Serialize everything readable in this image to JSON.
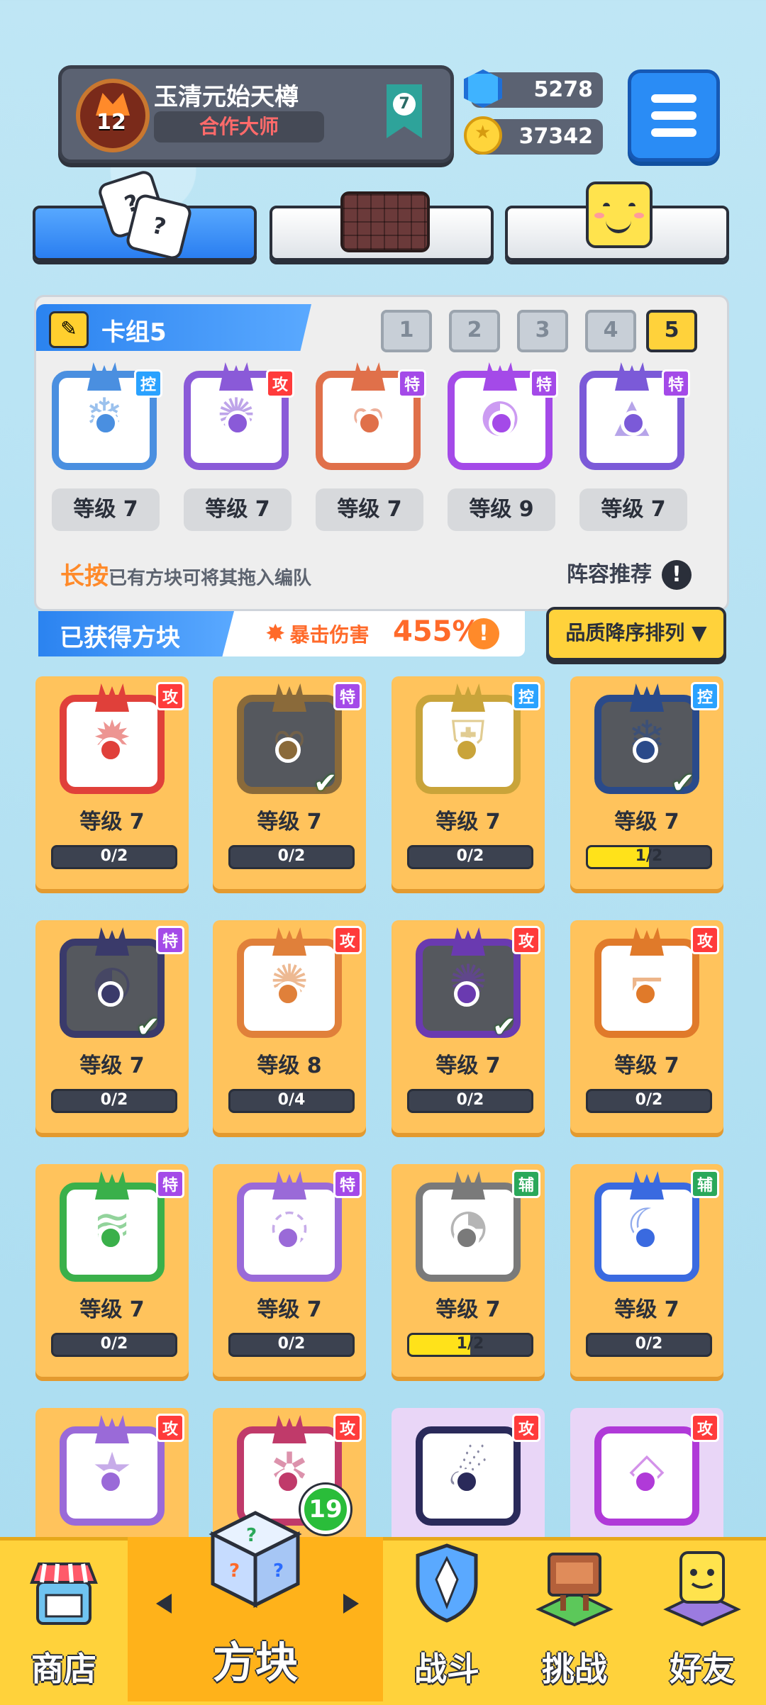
{
  "profile": {
    "level": "12",
    "name": "玉清元始天樽",
    "title": "合作大师",
    "rank": "7"
  },
  "currency": {
    "gems": "5278",
    "coins": "37342"
  },
  "tabs": [
    {
      "name": "dice"
    },
    {
      "name": "board"
    },
    {
      "name": "emoji"
    }
  ],
  "deck": {
    "label": "卡组5",
    "numbers": [
      "1",
      "2",
      "3",
      "4",
      "5"
    ],
    "active": "5",
    "cards": [
      {
        "tag": "控",
        "level": "等级 7",
        "glyph": "❄"
      },
      {
        "tag": "攻",
        "level": "等级 7",
        "glyph": "✺"
      },
      {
        "tag": "特",
        "level": "等级 7",
        "glyph": "∞"
      },
      {
        "tag": "特",
        "level": "等级 9",
        "glyph": "◐"
      },
      {
        "tag": "特",
        "level": "等级 7",
        "glyph": "▲"
      }
    ],
    "hint_highlight": "长按",
    "hint_text": "已有方块可将其拖入编队",
    "recommend": "阵容推荐",
    "recommend_icon": "!"
  },
  "obtained": {
    "label": "已获得方块",
    "crit_label": "暴击伤害",
    "crit_value": "455%",
    "crit_icon": "!",
    "sort_label": "品质降序排列 ▼"
  },
  "grid": [
    {
      "tag": "攻",
      "level": "等级 7",
      "progress": "0/2",
      "glyph": "✹"
    },
    {
      "tag": "特",
      "level": "等级 7",
      "progress": "0/2",
      "glyph": "∞",
      "checked": true
    },
    {
      "tag": "控",
      "level": "等级 7",
      "progress": "0/2",
      "glyph": "⛨"
    },
    {
      "tag": "控",
      "level": "等级 7",
      "progress": "1/2",
      "glyph": "❄",
      "checked": true
    },
    {
      "tag": "特",
      "level": "等级 7",
      "progress": "0/2",
      "glyph": "◐",
      "checked": true
    },
    {
      "tag": "攻",
      "level": "等级 8",
      "progress": "0/4",
      "glyph": "✺"
    },
    {
      "tag": "攻",
      "level": "等级 7",
      "progress": "0/2",
      "glyph": "✺",
      "checked": true
    },
    {
      "tag": "攻",
      "level": "等级 7",
      "progress": "0/2",
      "glyph": "⌐"
    },
    {
      "tag": "特",
      "level": "等级 7",
      "progress": "0/2",
      "glyph": "≋"
    },
    {
      "tag": "特",
      "level": "等级 7",
      "progress": "0/2",
      "glyph": "◌"
    },
    {
      "tag": "辅",
      "level": "等级 7",
      "progress": "1/2",
      "glyph": "◔"
    },
    {
      "tag": "辅",
      "level": "等级 7",
      "progress": "0/2",
      "glyph": "☾"
    },
    {
      "tag": "攻",
      "glyph": "★"
    },
    {
      "tag": "攻",
      "glyph": "✲"
    },
    {
      "tag": "攻",
      "glyph": "☄"
    },
    {
      "tag": "攻",
      "glyph": "◇"
    }
  ],
  "nav": {
    "shop": "商店",
    "blocks": "方块",
    "battle": "战斗",
    "challenge": "挑战",
    "friends": "好友",
    "blocks_badge": "19"
  },
  "colors": {
    "atk": "#ff3b3b",
    "ctrl": "#2aa2ff",
    "spec": "#a44ae8",
    "aux": "#2aa85a",
    "accent": "#ffd23b"
  }
}
